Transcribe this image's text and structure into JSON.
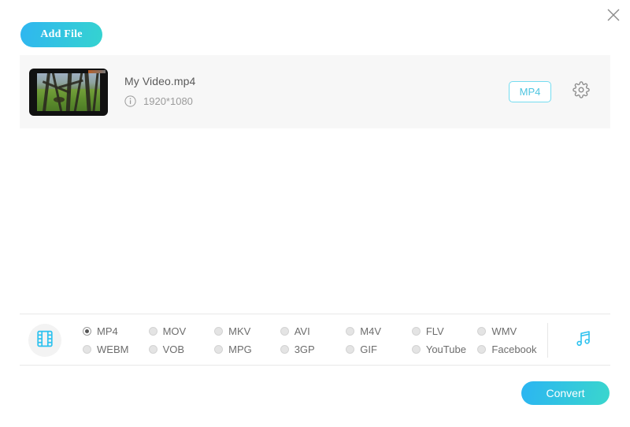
{
  "window": {
    "close_label": "×",
    "close_icon": "close-icon"
  },
  "toolbar": {
    "add_file_label": "Add File"
  },
  "file_list": [
    {
      "name": "My Video.mp4",
      "resolution": "1920*1080",
      "info_icon": "info-circle-icon",
      "output_format_badge": "MP4",
      "settings_icon": "gear-icon",
      "thumbnail_alt": "forest video thumbnail"
    }
  ],
  "format_panel": {
    "video_icon": "film-strip-icon",
    "audio_icon": "music-note-icon",
    "selected": "MP4",
    "options": [
      {
        "label": "MP4",
        "selected": true
      },
      {
        "label": "MOV",
        "selected": false
      },
      {
        "label": "MKV",
        "selected": false
      },
      {
        "label": "AVI",
        "selected": false
      },
      {
        "label": "M4V",
        "selected": false
      },
      {
        "label": "FLV",
        "selected": false
      },
      {
        "label": "WMV",
        "selected": false
      },
      {
        "label": "WEBM",
        "selected": false
      },
      {
        "label": "VOB",
        "selected": false
      },
      {
        "label": "MPG",
        "selected": false
      },
      {
        "label": "3GP",
        "selected": false
      },
      {
        "label": "GIF",
        "selected": false
      },
      {
        "label": "YouTube",
        "selected": false
      },
      {
        "label": "Facebook",
        "selected": false
      }
    ]
  },
  "footer": {
    "convert_label": "Convert"
  },
  "colors": {
    "accent_cyan": "#4ec5e0",
    "gradient_start": "#2bb5f2",
    "gradient_end": "#3ad6cd",
    "panel_bg": "#f7f7f7",
    "text_primary": "#5a5a5a",
    "text_secondary": "#9b9b9b"
  }
}
